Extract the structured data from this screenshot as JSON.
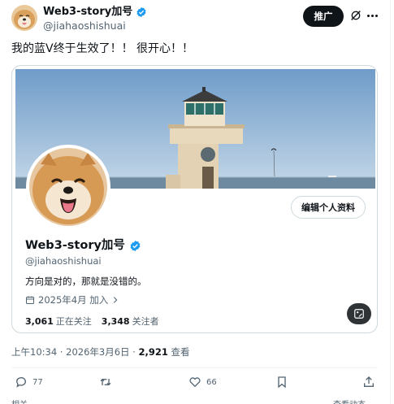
{
  "author": {
    "name": "Web3-story加号",
    "handle": "@jiahaoshishuai"
  },
  "header": {
    "promote_label": "推广"
  },
  "tweet": {
    "text": "我的蓝V终于生效了！！ 很开心！！"
  },
  "card": {
    "edit_label": "编辑个人资料",
    "name": "Web3-story加号",
    "handle": "@jiahaoshishuai",
    "bio": "方向是对的，那就是没错的。",
    "joined": "2025年4月 加入",
    "following_count": "3,061",
    "following_label": "正在关注",
    "followers_count": "3,348",
    "followers_label": "关注者"
  },
  "meta": {
    "time": "上午10:34",
    "sep": " · ",
    "date": "2026年3月6日",
    "views_count": "2,921",
    "views_label": " 查看"
  },
  "actions": {
    "replies": "77",
    "likes": "66"
  },
  "footer": {
    "left_cut": "相关",
    "right_cut": "查看动态"
  },
  "colors": {
    "verified": "#1d9bf0",
    "primary_text": "#0f1419",
    "secondary_text": "#536471",
    "border": "#cfd9de"
  }
}
